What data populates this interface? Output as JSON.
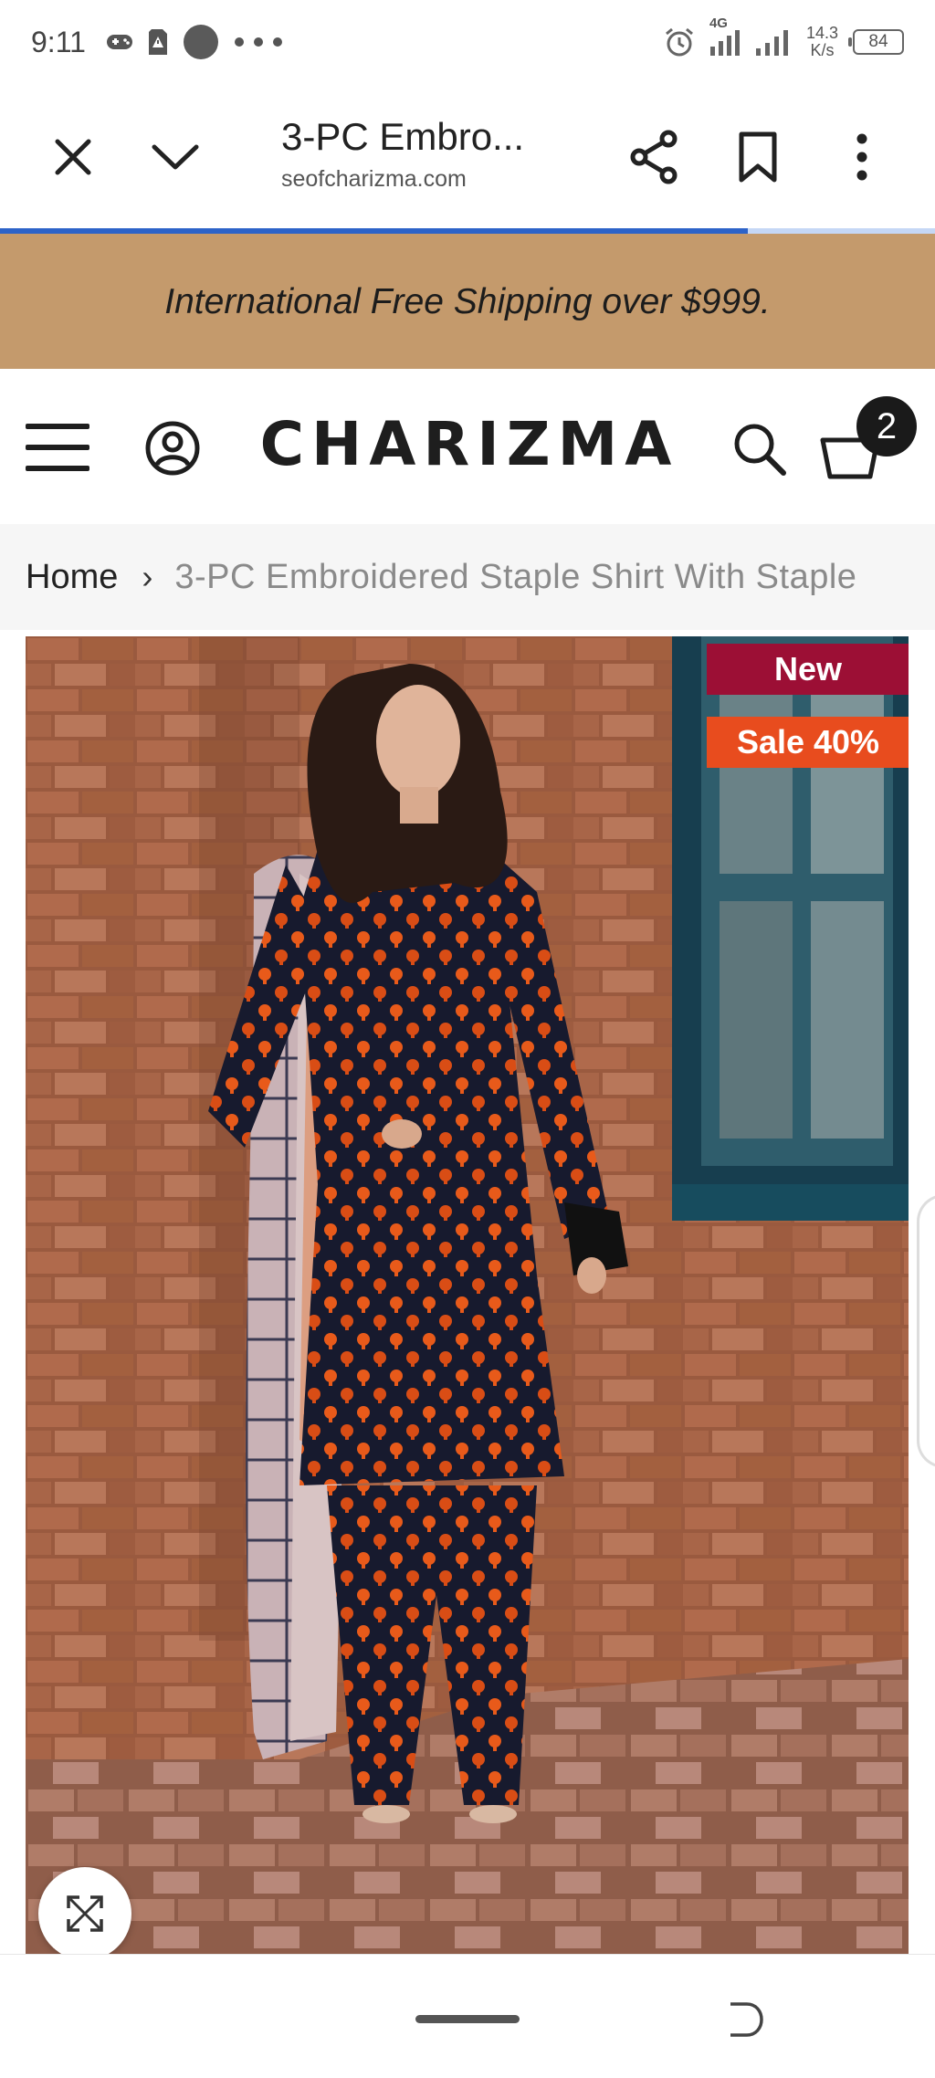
{
  "status_bar": {
    "time": "9:11",
    "network_label": "4G",
    "speed_value": "14.3",
    "speed_unit": "K/s",
    "battery_level": "84"
  },
  "browser": {
    "page_title": "3-PC Embro...",
    "url": "seofcharizma.com",
    "load_progress": 0.8,
    "icons": [
      "close-icon",
      "chevron-down-icon",
      "share-icon",
      "bookmark-icon",
      "more-vert-icon"
    ]
  },
  "banner": {
    "text": "International Free Shipping over $999."
  },
  "header": {
    "logo": "CHARIZMA",
    "cart_count": "2",
    "icons": [
      "menu-icon",
      "account-icon",
      "search-icon",
      "cart-icon"
    ]
  },
  "breadcrumb": {
    "home": "Home",
    "separator": "›",
    "current": "3-PC Embroidered Staple Shirt With Staple"
  },
  "product": {
    "badges": {
      "new": "New",
      "sale": "Sale 40%"
    },
    "badge_colors": {
      "new": "#9c0f35",
      "sale": "#e84c1e"
    }
  },
  "colors": {
    "banner_bg": "#c49a6c",
    "progress": "#2d63c8"
  }
}
